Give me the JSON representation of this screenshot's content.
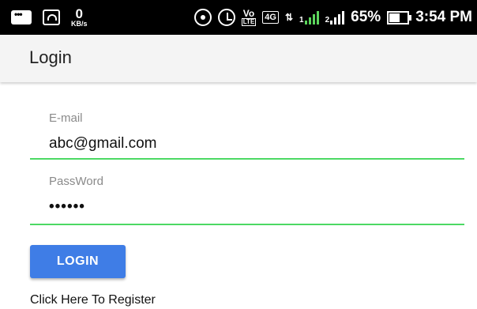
{
  "status_bar": {
    "data_speed_value": "0",
    "data_speed_unit": "KB/s",
    "volte_top": "Vo",
    "volte_bottom": "LTE",
    "network_type": "4G",
    "sim1_label": "1",
    "sim2_label": "2",
    "battery_percent": "65%",
    "battery_level": 0.65,
    "time": "3:54 PM",
    "icons": [
      "message-icon",
      "screen-cast-icon",
      "hotspot-icon",
      "alarm-icon",
      "signal-icon",
      "battery-icon"
    ]
  },
  "app_bar": {
    "title": "Login"
  },
  "form": {
    "email": {
      "label": "E-mail",
      "value": "abc@gmail.com"
    },
    "password": {
      "label": "PassWord",
      "value": "••••••"
    },
    "login_button_label": "LOGIN",
    "register_link": "Click Here To Register"
  },
  "colors": {
    "status_bar_bg": "#000000",
    "app_bar_bg": "#f4f4f4",
    "field_underline": "#4cd964",
    "button_bg": "#3f7de6",
    "signal_green": "#5cd65c"
  }
}
